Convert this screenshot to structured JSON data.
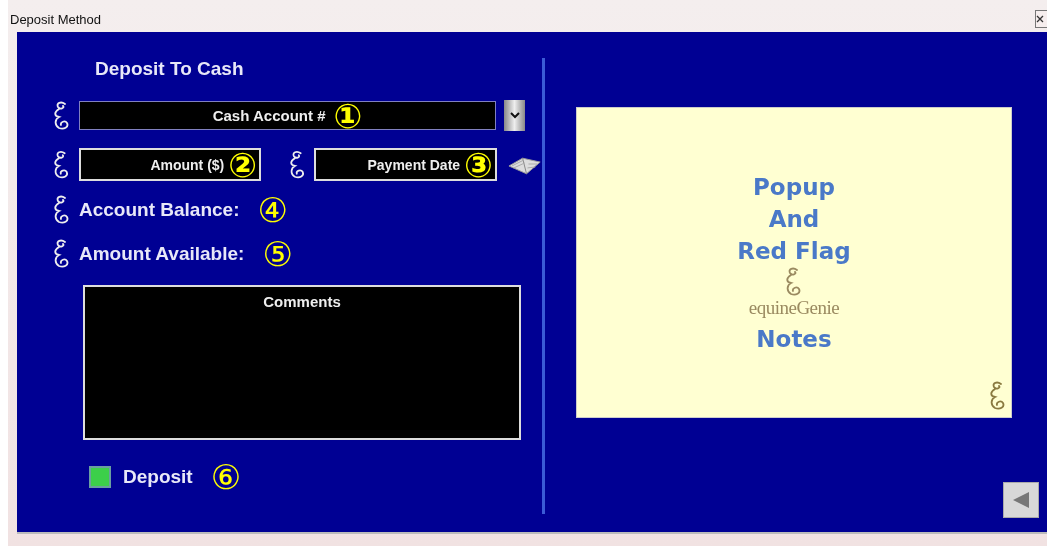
{
  "window": {
    "title": "Deposit Method"
  },
  "heading": "Deposit To Cash",
  "account_dropdown": {
    "label": "Cash Account #",
    "callout": "①"
  },
  "amount_field": {
    "label": "Amount ($)",
    "callout": "②"
  },
  "payment_date_field": {
    "label": "Payment Date",
    "callout": "③"
  },
  "info_rows": [
    {
      "label": "Account Balance:",
      "callout": "④"
    },
    {
      "label": "Amount Available:",
      "callout": "⑤"
    }
  ],
  "comments": {
    "label": "Comments"
  },
  "deposit": {
    "label": "Deposit",
    "checked": true,
    "callout": "⑥"
  },
  "notes_panel": {
    "lines": [
      "Popup",
      "And",
      "Red Flag"
    ],
    "logo": "equineGenie",
    "footer": "Notes"
  }
}
